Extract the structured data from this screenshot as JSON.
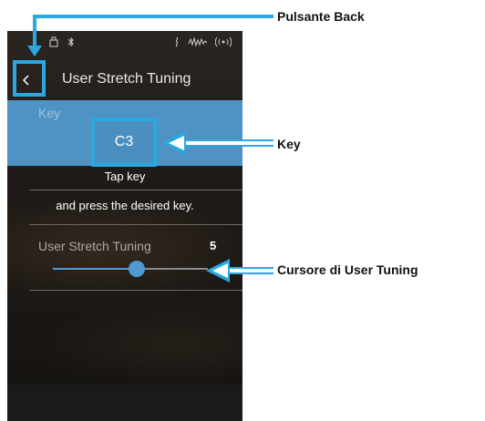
{
  "status_bar": {
    "icons": [
      "usb-icon",
      "bluetooth-icon",
      "mic-icon",
      "waveform-icon",
      "wireless-icon"
    ]
  },
  "nav": {
    "title": "User Stretch Tuning"
  },
  "key_section": {
    "label": "Key",
    "value": "C3"
  },
  "instructions": {
    "line1": "Tap key",
    "line2": "and press the desired key."
  },
  "stretch": {
    "label": "User Stretch Tuning",
    "value": "5",
    "slider_position": 0.54
  },
  "callouts": {
    "back": "Pulsante Back",
    "key": "Key",
    "cursor": "Cursore di User Tuning"
  },
  "colors": {
    "accent": "#2aa8e0",
    "band": "#4f93c4",
    "slider": "#4f9ad2"
  }
}
